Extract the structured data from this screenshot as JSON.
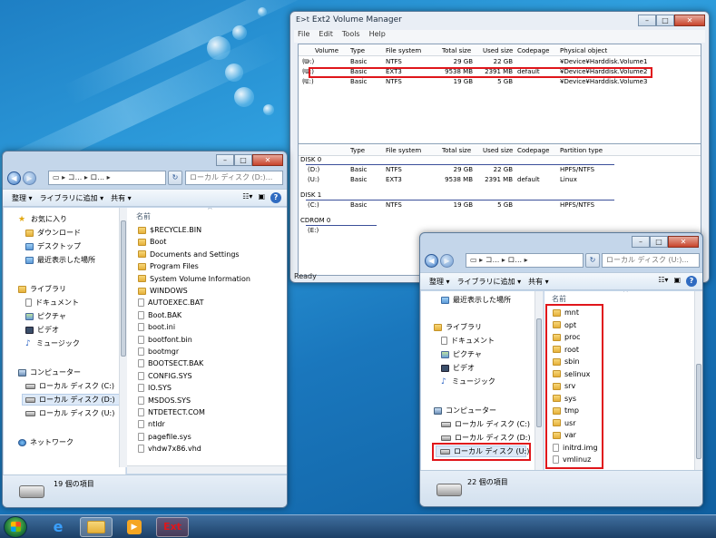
{
  "ext2": {
    "title": "Ext2 Volume Manager",
    "menu": [
      "File",
      "Edit",
      "Tools",
      "Help"
    ],
    "volume_columns": [
      "Volume",
      "Type",
      "File system",
      "Total size",
      "Used size",
      "Codepage",
      "Physical object"
    ],
    "volumes": [
      {
        "volume": "(D:)",
        "type": "Basic",
        "fs": "NTFS",
        "total": "29 GB",
        "used": "22 GB",
        "codepage": "",
        "object": "¥Device¥Harddisk.Volume1"
      },
      {
        "volume": "(U:)",
        "type": "Basic",
        "fs": "EXT3",
        "total": "9538 MB",
        "used": "2391 MB",
        "codepage": "default",
        "object": "¥Device¥Harddisk.Volume2"
      },
      {
        "volume": "(C:)",
        "type": "Basic",
        "fs": "NTFS",
        "total": "19 GB",
        "used": "5 GB",
        "codepage": "",
        "object": "¥Device¥Harddisk.Volume3"
      }
    ],
    "disk_columns": [
      "Type",
      "File system",
      "Total size",
      "Used size",
      "Codepage",
      "Partition type"
    ],
    "disks": [
      {
        "label": "DISK 0",
        "parts": [
          {
            "vol": "(D:)",
            "type": "Basic",
            "fs": "NTFS",
            "total": "29 GB",
            "used": "22 GB",
            "codepage": "",
            "ptype": "HPFS/NTFS"
          },
          {
            "vol": "(U:)",
            "type": "Basic",
            "fs": "EXT3",
            "total": "9538 MB",
            "used": "2391 MB",
            "codepage": "default",
            "ptype": "Linux"
          }
        ]
      },
      {
        "label": "DISK 1",
        "parts": [
          {
            "vol": "(C:)",
            "type": "Basic",
            "fs": "NTFS",
            "total": "19 GB",
            "used": "5 GB",
            "codepage": "",
            "ptype": "HPFS/NTFS"
          }
        ]
      },
      {
        "label": "CDROM 0",
        "parts": [
          {
            "vol": "(E:)",
            "type": "",
            "fs": "",
            "total": "",
            "used": "",
            "codepage": "",
            "ptype": ""
          }
        ]
      }
    ],
    "status": "Ready"
  },
  "left_explorer": {
    "address": [
      "コ...",
      "ロ..."
    ],
    "search_placeholder": "ローカル ディスク (D:)...",
    "commands": [
      "整理 ▾",
      "ライブラリに追加 ▾",
      "共有 ▾"
    ],
    "nav": {
      "favorites": "お気に入り",
      "downloads": "ダウンロード",
      "desktop": "デスクトップ",
      "recent": "最近表示した場所",
      "libraries": "ライブラリ",
      "documents": "ドキュメント",
      "pictures": "ピクチャ",
      "videos": "ビデオ",
      "music": "ミュージック",
      "computer": "コンピューター",
      "drive_c": "ローカル ディスク (C:)",
      "drive_d": "ローカル ディスク (D:)",
      "drive_u": "ローカル ディスク (U:)",
      "network": "ネットワーク"
    },
    "column_name": "名前",
    "files": [
      {
        "name": "$RECYCLE.BIN",
        "kind": "folder"
      },
      {
        "name": "Boot",
        "kind": "folder"
      },
      {
        "name": "Documents and Settings",
        "kind": "folder"
      },
      {
        "name": "Program Files",
        "kind": "folder"
      },
      {
        "name": "System Volume Information",
        "kind": "folder"
      },
      {
        "name": "WINDOWS",
        "kind": "folder"
      },
      {
        "name": "AUTOEXEC.BAT",
        "kind": "file"
      },
      {
        "name": "Boot.BAK",
        "kind": "file"
      },
      {
        "name": "boot.ini",
        "kind": "file"
      },
      {
        "name": "bootfont.bin",
        "kind": "file"
      },
      {
        "name": "bootmgr",
        "kind": "file"
      },
      {
        "name": "BOOTSECT.BAK",
        "kind": "file"
      },
      {
        "name": "CONFIG.SYS",
        "kind": "file"
      },
      {
        "name": "IO.SYS",
        "kind": "file"
      },
      {
        "name": "MSDOS.SYS",
        "kind": "file"
      },
      {
        "name": "NTDETECT.COM",
        "kind": "file"
      },
      {
        "name": "ntldr",
        "kind": "file"
      },
      {
        "name": "pagefile.sys",
        "kind": "file"
      },
      {
        "name": "vhdw7x86.vhd",
        "kind": "file"
      }
    ],
    "status": "19 個の項目"
  },
  "right_explorer": {
    "address": [
      "コ...",
      "ロ..."
    ],
    "search_placeholder": "ローカル ディスク (U:)...",
    "commands": [
      "整理 ▾",
      "ライブラリに追加 ▾",
      "共有 ▾"
    ],
    "nav": {
      "recent": "最近表示した場所",
      "libraries": "ライブラリ",
      "documents": "ドキュメント",
      "pictures": "ピクチャ",
      "videos": "ビデオ",
      "music": "ミュージック",
      "computer": "コンピューター",
      "drive_c": "ローカル ディスク (C:)",
      "drive_d": "ローカル ディスク (D:)",
      "drive_u": "ローカル ディスク (U:)"
    },
    "column_name": "名前",
    "files": [
      {
        "name": "mnt",
        "kind": "folder"
      },
      {
        "name": "opt",
        "kind": "folder"
      },
      {
        "name": "proc",
        "kind": "folder"
      },
      {
        "name": "root",
        "kind": "folder"
      },
      {
        "name": "sbin",
        "kind": "folder"
      },
      {
        "name": "selinux",
        "kind": "folder"
      },
      {
        "name": "srv",
        "kind": "folder"
      },
      {
        "name": "sys",
        "kind": "folder"
      },
      {
        "name": "tmp",
        "kind": "folder"
      },
      {
        "name": "usr",
        "kind": "folder"
      },
      {
        "name": "var",
        "kind": "folder"
      },
      {
        "name": "initrd.img",
        "kind": "file"
      },
      {
        "name": "vmlinuz",
        "kind": "file"
      }
    ],
    "status": "22 個の項目"
  },
  "highlight_color": "#e0161b",
  "taskbar": {
    "ext2_label": "Ext"
  }
}
